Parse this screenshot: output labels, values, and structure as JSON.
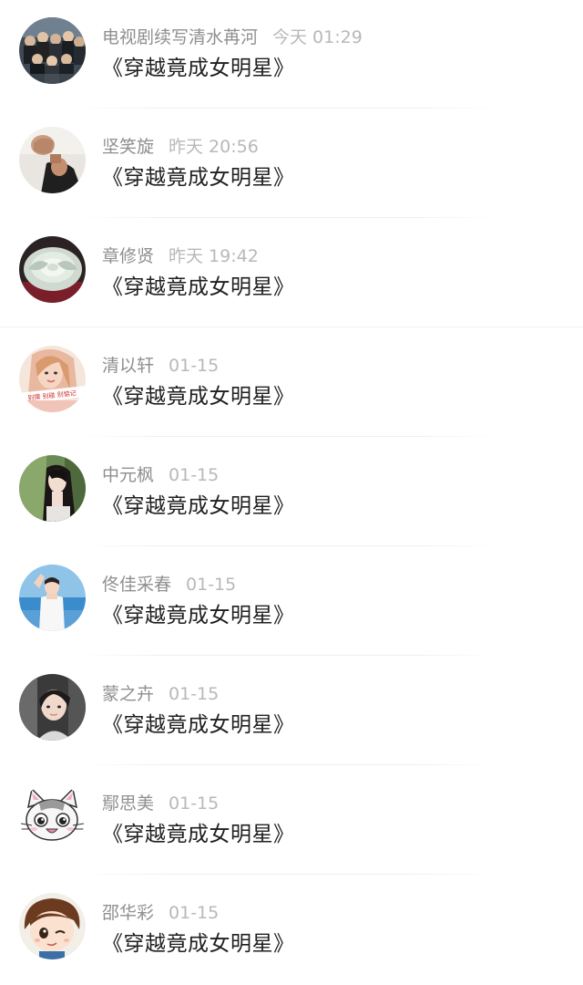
{
  "items": [
    {
      "name": "电视剧续写清水苒河",
      "time": "今天 01:29",
      "title": "《穿越竟成女明星》",
      "avatar_icon": "group-photo-avatar"
    },
    {
      "name": "坚笑旋",
      "time": "昨天 20:56",
      "title": "《穿越竟成女明星》",
      "avatar_icon": "man-fist-avatar"
    },
    {
      "name": "章修贤",
      "time": "昨天 19:42",
      "title": "《穿越竟成女明星》",
      "avatar_icon": "white-flower-avatar"
    },
    {
      "name": "清以轩",
      "time": "01-15",
      "title": "《穿越竟成女明星》",
      "avatar_icon": "girl-banner-avatar"
    },
    {
      "name": "中元枫",
      "time": "01-15",
      "title": "《穿越竟成女明星》",
      "avatar_icon": "girl-long-hair-avatar"
    },
    {
      "name": "佟佳采春",
      "time": "01-15",
      "title": "《穿越竟成女明星》",
      "avatar_icon": "beach-man-avatar"
    },
    {
      "name": "蒙之卉",
      "time": "01-15",
      "title": "《穿越竟成女明星》",
      "avatar_icon": "boy-portrait-avatar"
    },
    {
      "name": "鄢思美",
      "time": "01-15",
      "title": "《穿越竟成女明星》",
      "avatar_icon": "cartoon-cat-avatar"
    },
    {
      "name": "邵华彩",
      "time": "01-15",
      "title": "《穿越竟成女明星》",
      "avatar_icon": "cartoon-boy-avatar"
    }
  ]
}
